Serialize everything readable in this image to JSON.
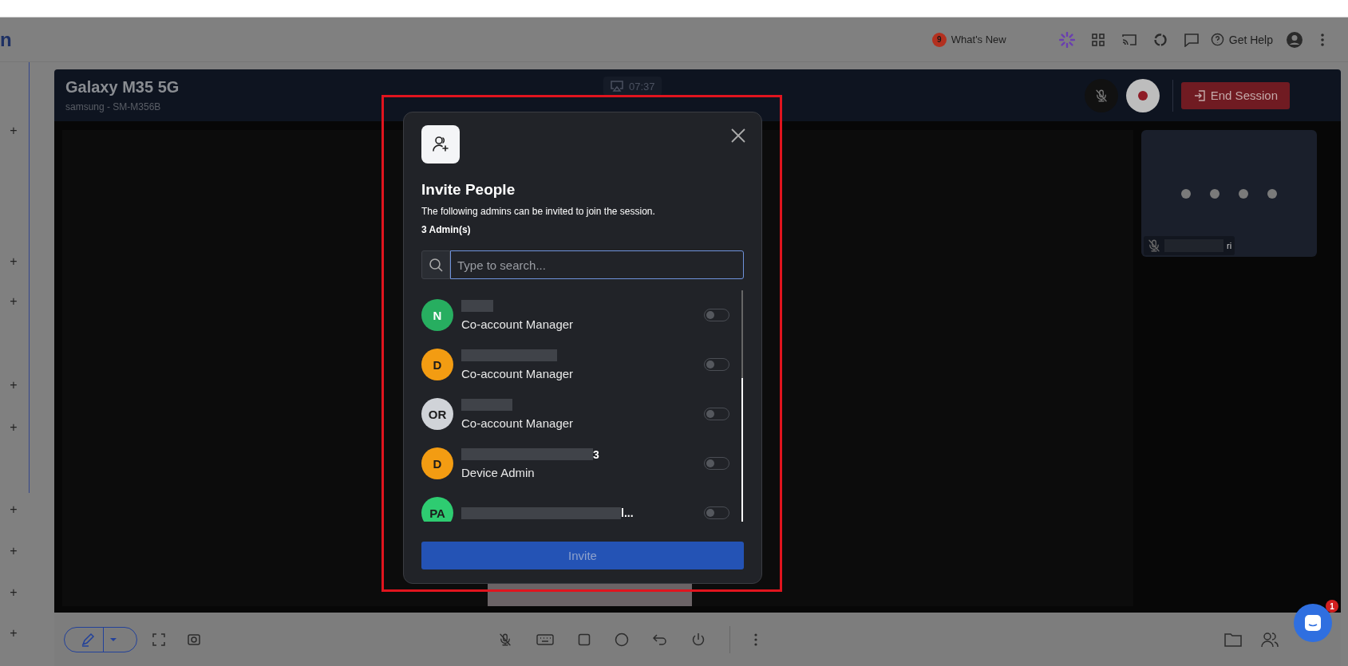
{
  "app_bar": {
    "logo_fragment": "n",
    "whats_new": {
      "badge": "9",
      "label": "What's New"
    },
    "help_label": "Get Help"
  },
  "sidebar": {
    "items": [
      "+",
      "+",
      "+",
      "+",
      "+",
      "+",
      "+",
      "+",
      "+"
    ]
  },
  "device": {
    "name": "Galaxy M35 5G",
    "model": "samsung - SM-M356B",
    "timer": "07:37",
    "mic_muted": true,
    "recording": true,
    "end_session": "End Session"
  },
  "participant_tile": {
    "name_tail": "ri",
    "mic_muted": true
  },
  "toolbar": {
    "mic_muted": true
  },
  "chat_launcher": {
    "badge": "1"
  },
  "dialog": {
    "title": "Invite People",
    "description": "The following admins can be invited to join the session.",
    "count": "3 Admin(s)",
    "search": {
      "placeholder": "Type to search..."
    },
    "admins": [
      {
        "initials": "N",
        "color": "#27ae60",
        "role": "Co-account Manager",
        "on": false
      },
      {
        "initials": "D",
        "color": "#f39c12",
        "role": "Co-account Manager",
        "on": false
      },
      {
        "initials": "OR",
        "color": "#d0d3d8",
        "role": "Co-account Manager",
        "on": false
      },
      {
        "initials": "D",
        "color": "#f39c12",
        "name_tail": "3",
        "role": "Device Admin",
        "on": false
      },
      {
        "initials": "PA",
        "color": "#2ecc71",
        "name_tail": "l...",
        "on": false
      }
    ],
    "invite_button": {
      "label": "Invite",
      "disabled": true
    }
  }
}
